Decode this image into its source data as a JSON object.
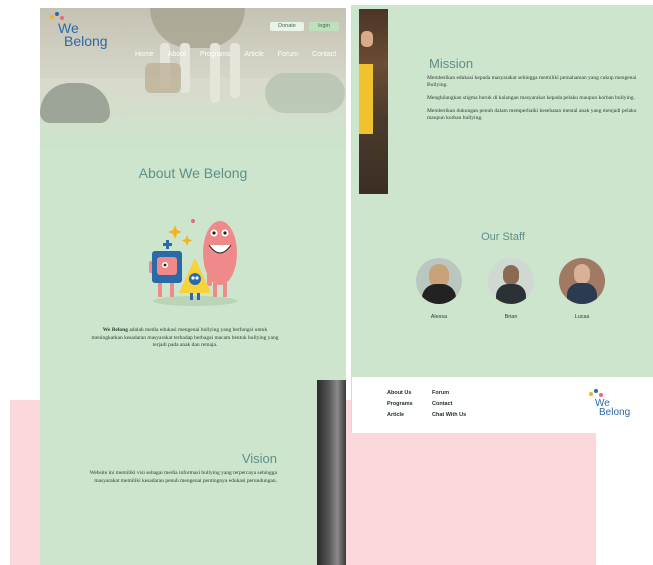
{
  "brand": {
    "line1": "We",
    "line2": "Belong"
  },
  "header": {
    "donate_label": "Donate",
    "login_label": "login",
    "nav": [
      "Home",
      "About",
      "Programs",
      "Article",
      "Forum",
      "Contact"
    ]
  },
  "about": {
    "title": "About We Belong",
    "brand_name": "We Belong",
    "text": "adalah media edukasi mengenai bullying yang berfungsi untuk meningkatkan kesadaran masyarakat terhadap berbagai macam bentuk bullying yang terjadi pada anak dan remaja."
  },
  "vision": {
    "title": "Vision",
    "text": "Website ini memiliki visi sebagai media informasi bullying yang terpercaya sehingga masyarakat memiliki kesadaran penuh mengenai pentingnya edukasi perundungan."
  },
  "mission": {
    "title": "Mission",
    "items": [
      "Memberikan edukasi kepada masyarakat sehingga memiliki pemahaman yang cukup mengenai Bullying.",
      "Menghilangkan stigma buruk di kalangan masyarakat kepada pelaku maupun korban bullying.",
      "Memberikan dukungan penuh dalam memperbaiki kesehatan mental anak yang menjadi pelaku maupun korban bullying."
    ]
  },
  "staff": {
    "title": "Our Staff",
    "members": [
      {
        "name": "Alessa"
      },
      {
        "name": "Brian"
      },
      {
        "name": "Lucas"
      }
    ]
  },
  "footer": {
    "col1": [
      "About Us",
      "Programs",
      "Article"
    ],
    "col2": [
      "Forum",
      "Contact",
      "Chat With Us"
    ]
  },
  "colors": {
    "background_green": "#cde5cc",
    "heading_teal": "#5f8f8a",
    "accent_pink": "#fcd8dd",
    "logo_blue": "#2a6aa8"
  }
}
